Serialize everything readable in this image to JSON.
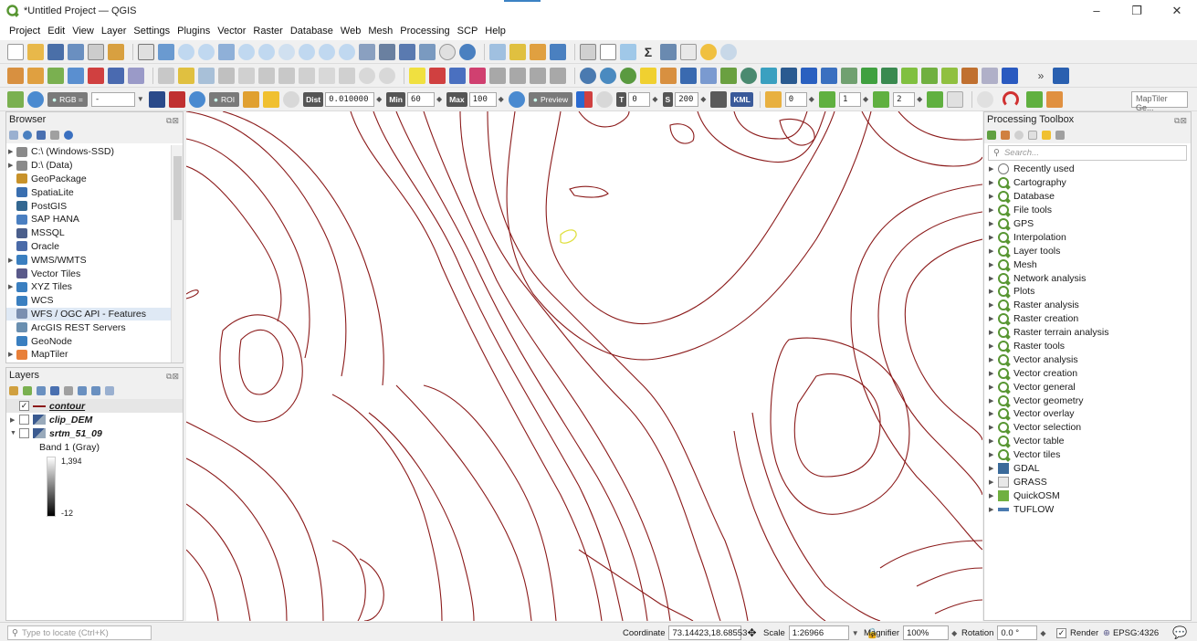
{
  "window": {
    "title": "*Untitled Project — QGIS",
    "controls": [
      "–",
      "❐",
      "✕"
    ]
  },
  "menubar": [
    "Project",
    "Edit",
    "View",
    "Layer",
    "Settings",
    "Plugins",
    "Vector",
    "Raster",
    "Database",
    "Web",
    "Mesh",
    "Processing",
    "SCP",
    "Help"
  ],
  "scp_toolbar": {
    "rgb_label": "RGB =",
    "rgb_value": "-",
    "roi_label": "ROI",
    "dist_label": "Dist",
    "dist_value": "0.010000",
    "min_label": "Min",
    "min_value": "60",
    "max_label": "Max",
    "max_value": "100",
    "preview_label": "Preview",
    "t_label": "T",
    "t_value": "0",
    "s_label": "S",
    "s_value": "200",
    "kml_label": "KML",
    "band_value_1": "0",
    "band_value_2": "1",
    "band_value_3": "2",
    "maptiler_search": "MapTiler Ge..."
  },
  "browser": {
    "title": "Browser",
    "items": [
      {
        "label": "C:\\ (Windows-SSD)",
        "expandable": true,
        "icon": "drive-icon",
        "color": "#8a8a8a"
      },
      {
        "label": "D:\\ (Data)",
        "expandable": true,
        "icon": "drive-icon",
        "color": "#8a8a8a"
      },
      {
        "label": "GeoPackage",
        "expandable": false,
        "icon": "geopackage-icon",
        "color": "#c8922a"
      },
      {
        "label": "SpatiaLite",
        "expandable": false,
        "icon": "spatialite-icon",
        "color": "#3a6fb0"
      },
      {
        "label": "PostGIS",
        "expandable": false,
        "icon": "postgis-icon",
        "color": "#336791"
      },
      {
        "label": "SAP HANA",
        "expandable": false,
        "icon": "saphana-icon",
        "color": "#4a7fc1"
      },
      {
        "label": "MSSQL",
        "expandable": false,
        "icon": "mssql-icon",
        "color": "#4b5f8c"
      },
      {
        "label": "Oracle",
        "expandable": false,
        "icon": "oracle-icon",
        "color": "#4a6aa8"
      },
      {
        "label": "WMS/WMTS",
        "expandable": true,
        "icon": "wms-icon",
        "color": "#3a7fc0"
      },
      {
        "label": "Vector Tiles",
        "expandable": false,
        "icon": "vector-tiles-icon",
        "color": "#5a5a8a"
      },
      {
        "label": "XYZ Tiles",
        "expandable": true,
        "icon": "xyz-tiles-icon",
        "color": "#3a7fc0"
      },
      {
        "label": "WCS",
        "expandable": false,
        "icon": "wcs-icon",
        "color": "#3a7fc0"
      },
      {
        "label": "WFS / OGC API - Features",
        "expandable": false,
        "icon": "wfs-icon",
        "color": "#7a8fb0",
        "selected": true
      },
      {
        "label": "ArcGIS REST Servers",
        "expandable": false,
        "icon": "arcgis-icon",
        "color": "#6a8fb0"
      },
      {
        "label": "GeoNode",
        "expandable": false,
        "icon": "geonode-icon",
        "color": "#3a7fc0"
      },
      {
        "label": "MapTiler",
        "expandable": true,
        "icon": "maptiler-icon",
        "color": "#e8803a"
      }
    ]
  },
  "layers": {
    "title": "Layers",
    "items": [
      {
        "name": "contour",
        "checked": true,
        "style": "bold-underline",
        "symbol": "line-symbol-icon"
      },
      {
        "name": "clip_DEM",
        "checked": false,
        "style": "italic",
        "symbol": "raster-icon"
      },
      {
        "name": "srtm_51_09",
        "checked": false,
        "style": "italic",
        "symbol": "raster-icon"
      }
    ],
    "legend_band": "Band 1 (Gray)",
    "legend_max": "1,394",
    "legend_min": "-12"
  },
  "toolbox": {
    "title": "Processing Toolbox",
    "search_placeholder": "Search...",
    "items": [
      {
        "label": "Recently used",
        "icon": "clock-icon"
      },
      {
        "label": "Cartography",
        "icon": "qgis-icon"
      },
      {
        "label": "Database",
        "icon": "qgis-icon"
      },
      {
        "label": "File tools",
        "icon": "qgis-icon"
      },
      {
        "label": "GPS",
        "icon": "qgis-icon"
      },
      {
        "label": "Interpolation",
        "icon": "qgis-icon"
      },
      {
        "label": "Layer tools",
        "icon": "qgis-icon"
      },
      {
        "label": "Mesh",
        "icon": "qgis-icon"
      },
      {
        "label": "Network analysis",
        "icon": "qgis-icon"
      },
      {
        "label": "Plots",
        "icon": "qgis-icon"
      },
      {
        "label": "Raster analysis",
        "icon": "qgis-icon"
      },
      {
        "label": "Raster creation",
        "icon": "qgis-icon"
      },
      {
        "label": "Raster terrain analysis",
        "icon": "qgis-icon"
      },
      {
        "label": "Raster tools",
        "icon": "qgis-icon"
      },
      {
        "label": "Vector analysis",
        "icon": "qgis-icon"
      },
      {
        "label": "Vector creation",
        "icon": "qgis-icon"
      },
      {
        "label": "Vector general",
        "icon": "qgis-icon"
      },
      {
        "label": "Vector geometry",
        "icon": "qgis-icon"
      },
      {
        "label": "Vector overlay",
        "icon": "qgis-icon"
      },
      {
        "label": "Vector selection",
        "icon": "qgis-icon"
      },
      {
        "label": "Vector table",
        "icon": "qgis-icon"
      },
      {
        "label": "Vector tiles",
        "icon": "qgis-icon"
      },
      {
        "label": "GDAL",
        "icon": "gdal-icon"
      },
      {
        "label": "GRASS",
        "icon": "grass-icon"
      },
      {
        "label": "QuickOSM",
        "icon": "quickosm-icon"
      },
      {
        "label": "TUFLOW",
        "icon": "tuflow-icon"
      }
    ]
  },
  "statusbar": {
    "locate_placeholder": "Type to locate (Ctrl+K)",
    "coordinate_label": "Coordinate",
    "coordinate_value": "73.14423,18.68553",
    "scale_label": "Scale",
    "scale_value": "1:26966",
    "magnifier_label": "Magnifier",
    "magnifier_value": "100%",
    "rotation_label": "Rotation",
    "rotation_value": "0.0 °",
    "render_label": "Render",
    "crs_label": "EPSG:4326"
  },
  "colors": {
    "contour_line": "#8b1a1a",
    "selected_feature": "#e0e040",
    "qgis_green": "#589632"
  }
}
